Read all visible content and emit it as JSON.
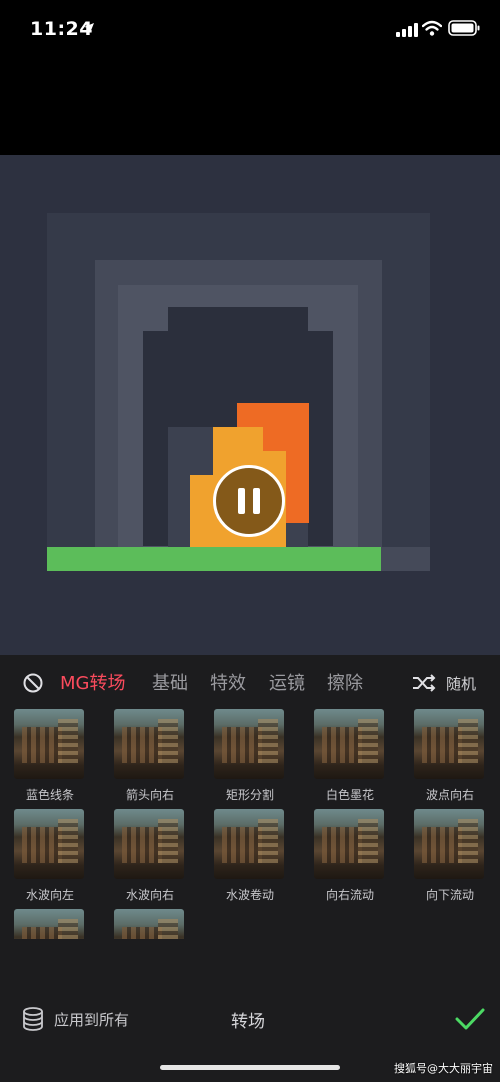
{
  "status_bar": {
    "time": "11:24"
  },
  "preview": {
    "state": "playing",
    "control_icon": "pause-icon"
  },
  "tabs": [
    {
      "label": "MG转场",
      "active": true
    },
    {
      "label": "基础",
      "active": false
    },
    {
      "label": "特效",
      "active": false
    },
    {
      "label": "运镜",
      "active": false
    },
    {
      "label": "擦除",
      "active": false
    }
  ],
  "random_label": "随机",
  "transitions": [
    "蓝色线条",
    "箭头向右",
    "矩形分割",
    "白色墨花",
    "波点向右",
    "水波向左",
    "水波向右",
    "水波卷动",
    "向右流动",
    "向下流动"
  ],
  "bottom": {
    "apply_all_label": "应用到所有",
    "title": "转场"
  },
  "watermark": "搜狐号@大大丽宇宙",
  "colors": {
    "accent": "#fb4b5d",
    "confirm": "#4cd964",
    "panel": "#1c1c1e"
  }
}
